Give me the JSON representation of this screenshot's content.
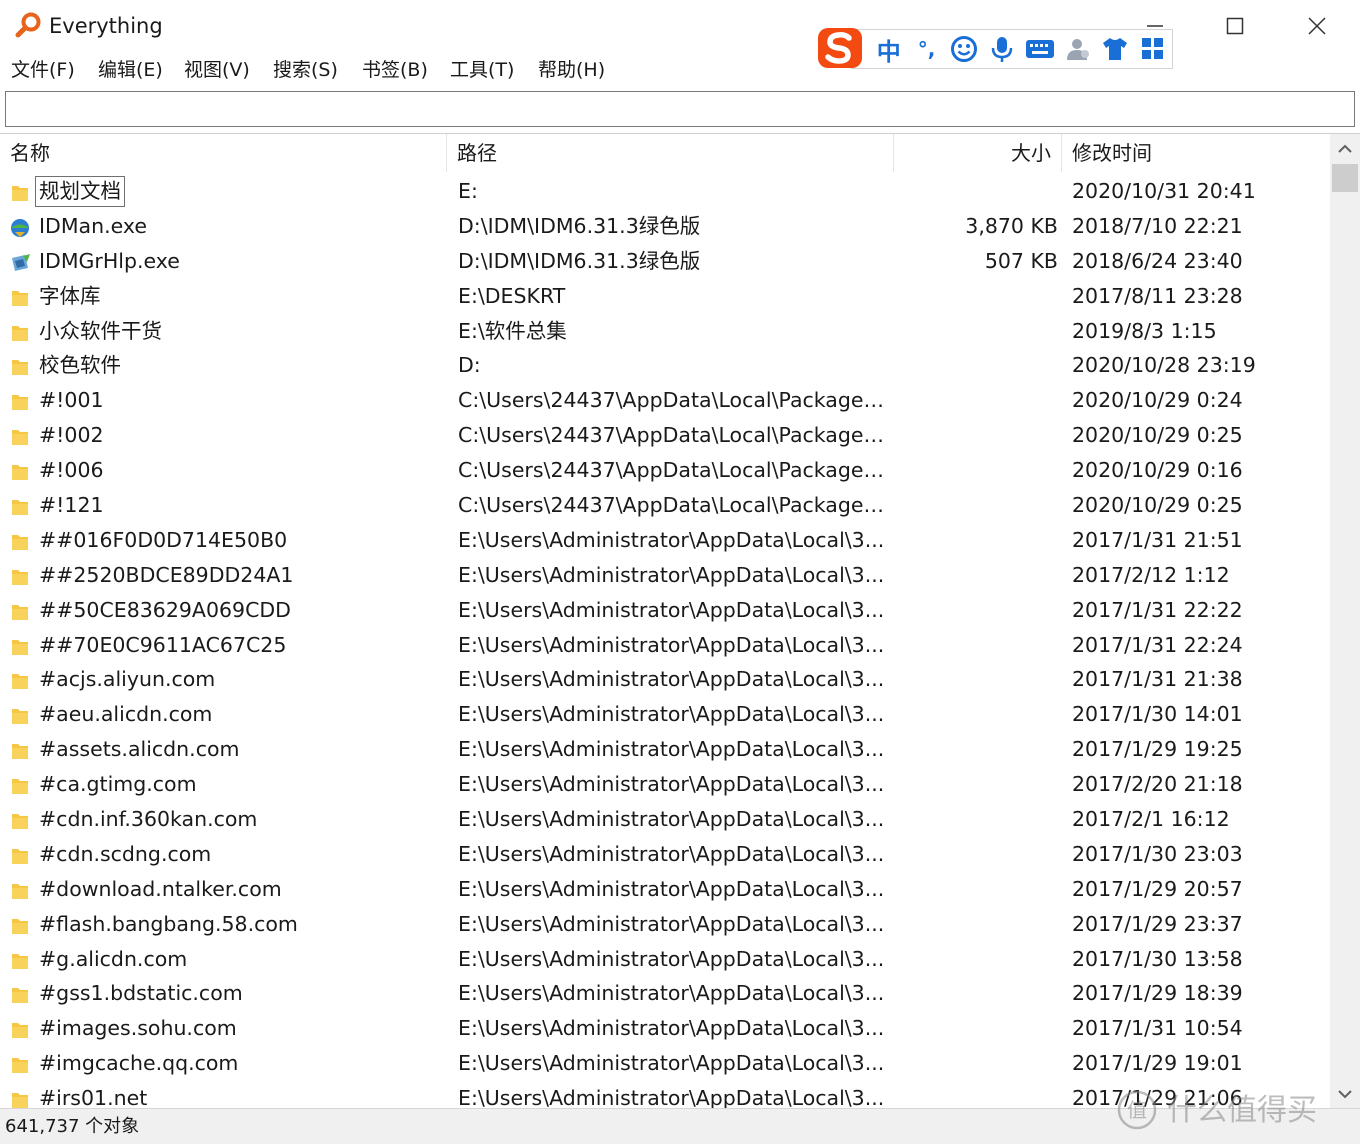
{
  "window": {
    "title": "Everything",
    "minimize": "minimize",
    "maximize": "maximize",
    "close": "close"
  },
  "menu": [
    "文件(F)",
    "编辑(E)",
    "视图(V)",
    "搜索(S)",
    "书签(B)",
    "工具(T)",
    "帮助(H)"
  ],
  "ime": {
    "mode": "中",
    "punct": "°,"
  },
  "search": {
    "value": "",
    "placeholder": ""
  },
  "columns": {
    "name": "名称",
    "path": "路径",
    "size": "大小",
    "modified": "修改时间"
  },
  "rows": [
    {
      "icon": "folder",
      "name": "规划文档",
      "path": "E:",
      "size": "",
      "date": "2020/10/31 20:41",
      "selected": true
    },
    {
      "icon": "idm-app",
      "name": "IDMan.exe",
      "path": "D:\\IDM\\IDM6.31.3绿色版",
      "size": "3,870 KB",
      "date": "2018/7/10 22:21"
    },
    {
      "icon": "idm-helper",
      "name": "IDMGrHlp.exe",
      "path": "D:\\IDM\\IDM6.31.3绿色版",
      "size": "507 KB",
      "date": "2018/6/24 23:40"
    },
    {
      "icon": "folder",
      "name": "字体库",
      "path": "E:\\DESKRT",
      "size": "",
      "date": "2017/8/11 23:28"
    },
    {
      "icon": "folder",
      "name": "小众软件干货",
      "path": "E:\\软件总集",
      "size": "",
      "date": "2019/8/3 1:15"
    },
    {
      "icon": "folder",
      "name": "校色软件",
      "path": "D:",
      "size": "",
      "date": "2020/10/28 23:19"
    },
    {
      "icon": "folder",
      "name": "#!001",
      "path": "C:\\Users\\24437\\AppData\\Local\\Packages...",
      "size": "",
      "date": "2020/10/29 0:24"
    },
    {
      "icon": "folder",
      "name": "#!002",
      "path": "C:\\Users\\24437\\AppData\\Local\\Packages...",
      "size": "",
      "date": "2020/10/29 0:25"
    },
    {
      "icon": "folder",
      "name": "#!006",
      "path": "C:\\Users\\24437\\AppData\\Local\\Packages...",
      "size": "",
      "date": "2020/10/29 0:16"
    },
    {
      "icon": "folder",
      "name": "#!121",
      "path": "C:\\Users\\24437\\AppData\\Local\\Packages...",
      "size": "",
      "date": "2020/10/29 0:25"
    },
    {
      "icon": "folder",
      "name": "##016F0D0D714E50B0",
      "path": "E:\\Users\\Administrator\\AppData\\Local\\3...",
      "size": "",
      "date": "2017/1/31 21:51"
    },
    {
      "icon": "folder",
      "name": "##2520BDCE89DD24A1",
      "path": "E:\\Users\\Administrator\\AppData\\Local\\3...",
      "size": "",
      "date": "2017/2/12 1:12"
    },
    {
      "icon": "folder",
      "name": "##50CE83629A069CDD",
      "path": "E:\\Users\\Administrator\\AppData\\Local\\3...",
      "size": "",
      "date": "2017/1/31 22:22"
    },
    {
      "icon": "folder",
      "name": "##70E0C9611AC67C25",
      "path": "E:\\Users\\Administrator\\AppData\\Local\\3...",
      "size": "",
      "date": "2017/1/31 22:24"
    },
    {
      "icon": "folder",
      "name": "#acjs.aliyun.com",
      "path": "E:\\Users\\Administrator\\AppData\\Local\\3...",
      "size": "",
      "date": "2017/1/31 21:38"
    },
    {
      "icon": "folder",
      "name": "#aeu.alicdn.com",
      "path": "E:\\Users\\Administrator\\AppData\\Local\\3...",
      "size": "",
      "date": "2017/1/30 14:01"
    },
    {
      "icon": "folder",
      "name": "#assets.alicdn.com",
      "path": "E:\\Users\\Administrator\\AppData\\Local\\3...",
      "size": "",
      "date": "2017/1/29 19:25"
    },
    {
      "icon": "folder",
      "name": "#ca.gtimg.com",
      "path": "E:\\Users\\Administrator\\AppData\\Local\\3...",
      "size": "",
      "date": "2017/2/20 21:18"
    },
    {
      "icon": "folder",
      "name": "#cdn.inf.360kan.com",
      "path": "E:\\Users\\Administrator\\AppData\\Local\\3...",
      "size": "",
      "date": "2017/2/1 16:12"
    },
    {
      "icon": "folder",
      "name": "#cdn.scdng.com",
      "path": "E:\\Users\\Administrator\\AppData\\Local\\3...",
      "size": "",
      "date": "2017/1/30 23:03"
    },
    {
      "icon": "folder",
      "name": "#download.ntalker.com",
      "path": "E:\\Users\\Administrator\\AppData\\Local\\3...",
      "size": "",
      "date": "2017/1/29 20:57"
    },
    {
      "icon": "folder",
      "name": "#flash.bangbang.58.com",
      "path": "E:\\Users\\Administrator\\AppData\\Local\\3...",
      "size": "",
      "date": "2017/1/29 23:37"
    },
    {
      "icon": "folder",
      "name": "#g.alicdn.com",
      "path": "E:\\Users\\Administrator\\AppData\\Local\\3...",
      "size": "",
      "date": "2017/1/30 13:58"
    },
    {
      "icon": "folder",
      "name": "#gss1.bdstatic.com",
      "path": "E:\\Users\\Administrator\\AppData\\Local\\3...",
      "size": "",
      "date": "2017/1/29 18:39"
    },
    {
      "icon": "folder",
      "name": "#images.sohu.com",
      "path": "E:\\Users\\Administrator\\AppData\\Local\\3...",
      "size": "",
      "date": "2017/1/31 10:54"
    },
    {
      "icon": "folder",
      "name": "#imgcache.qq.com",
      "path": "E:\\Users\\Administrator\\AppData\\Local\\3...",
      "size": "",
      "date": "2017/1/29 19:01"
    },
    {
      "icon": "folder",
      "name": "#irs01.net",
      "path": "E:\\Users\\Administrator\\AppData\\Local\\3...",
      "size": "",
      "date": "2017/1/29 21:06"
    }
  ],
  "status": {
    "count_text": "641,737 个对象"
  },
  "watermark": {
    "text": "值 什么值得买"
  },
  "colors": {
    "folder": "#f6c744",
    "ime_brand": "#f24a10",
    "ime_blue": "#1a6fd6"
  }
}
